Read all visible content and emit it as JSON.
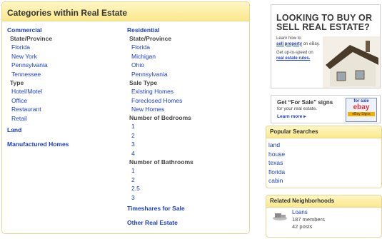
{
  "categories": {
    "title": "Categories within Real Estate",
    "commercial": {
      "heading": "Commercial",
      "state_label": "State/Province",
      "states": [
        "Florida",
        "New York",
        "Pennsylvania",
        "Tennessee"
      ],
      "type_label": "Type",
      "types": [
        "Hotel/Motel",
        "Office",
        "Restaurant",
        "Retail"
      ]
    },
    "land": "Land",
    "manufactured_homes": "Manufactured Homes",
    "residential": {
      "heading": "Residential",
      "state_label": "State/Province",
      "states": [
        "Florida",
        "Michigan",
        "Ohio",
        "Pennsylvania"
      ],
      "sale_type_label": "Sale Type",
      "sale_types": [
        "Existing Homes",
        "Foreclosed Homes",
        "New Homes"
      ],
      "bedrooms_label": "Number of Bedrooms",
      "bedrooms": [
        "1",
        "2",
        "3",
        "4"
      ],
      "bathrooms_label": "Number of Bathrooms",
      "bathrooms": [
        "1",
        "2",
        "2.5",
        "3"
      ]
    },
    "timeshares": "Timeshares for Sale",
    "other": "Other Real Estate"
  },
  "ad_buy_sell": {
    "headline_line1": "LOOKING TO BUY OR",
    "headline_line2": "SELL REAL ESTATE?",
    "learn_prefix": "Learn how to",
    "learn_link": "sell property",
    "learn_suffix": "on eBay.",
    "update_prefix": "Get up-to-speed on",
    "update_link": "real estate rules."
  },
  "ad_signs": {
    "title": "Get “For Sale” signs",
    "subtitle": "for your real estate.",
    "cta": "Learn more ▸",
    "badge_top": "for sale",
    "badge_logo": "ebay",
    "badge_bottom": "eBay Signs"
  },
  "popular_searches": {
    "title": "Popular Searches",
    "items": [
      "land",
      "house",
      "texas",
      "florida",
      "cabin"
    ]
  },
  "related_neighborhoods": {
    "title": "Related Neighborhoods",
    "name": "Loans",
    "members": "187 members",
    "posts": "42 posts"
  },
  "colors": {
    "link": "#1a3ec9",
    "header_gradient_top": "#fff6c4",
    "header_gradient_bottom": "#fbe88c"
  }
}
